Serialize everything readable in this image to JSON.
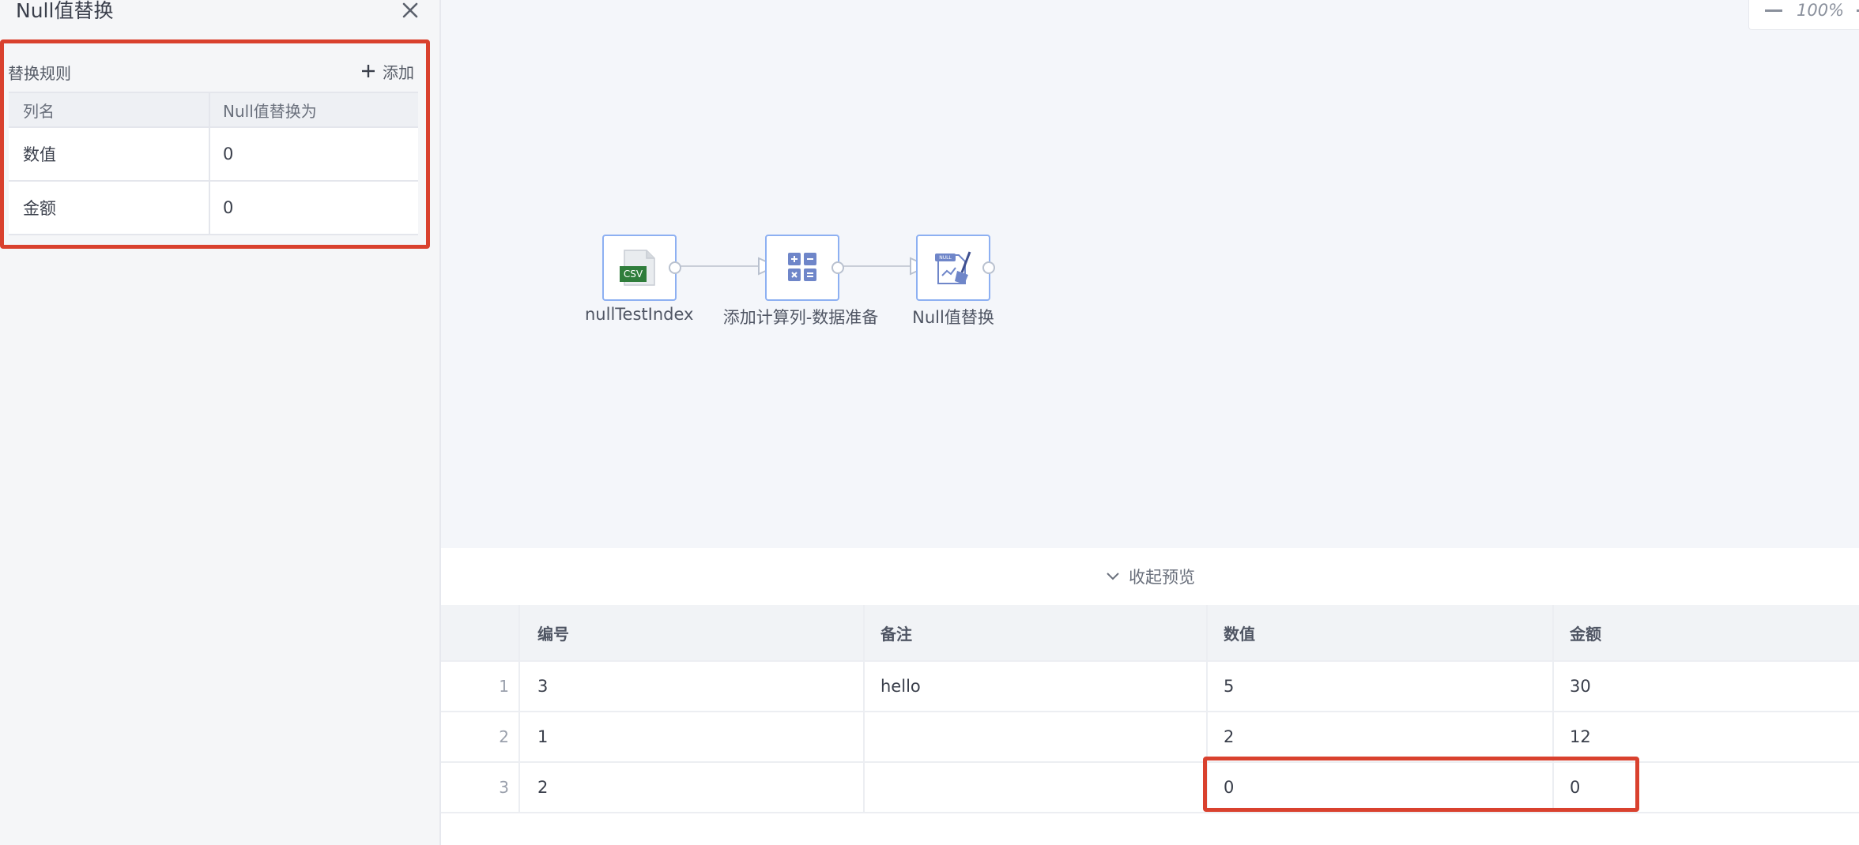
{
  "panel": {
    "title": "Null值替换",
    "rules_label": "替换规则",
    "add_label": "添加",
    "table_headers": [
      "列名",
      "Null值替换为"
    ],
    "rows": [
      {
        "column": "数值",
        "value": "0"
      },
      {
        "column": "金额",
        "value": "0"
      }
    ]
  },
  "zoom": {
    "value": "100%"
  },
  "flow": {
    "nodes": [
      {
        "label": "nullTestIndex",
        "icon": "csv-file-icon",
        "badge": "CSV"
      },
      {
        "label": "添加计算列-数据准备",
        "icon": "calculator-icon"
      },
      {
        "label": "Null值替换",
        "icon": "null-replace-broom-icon",
        "badge": "NULL"
      }
    ]
  },
  "preview": {
    "collapse_label": "收起预览",
    "headers": [
      "编号",
      "备注",
      "数值",
      "金额"
    ],
    "rows": [
      {
        "index": "1",
        "cells": [
          "3",
          "hello",
          "5",
          "30"
        ]
      },
      {
        "index": "2",
        "cells": [
          "1",
          "",
          "2",
          "12"
        ]
      },
      {
        "index": "3",
        "cells": [
          "2",
          "",
          "0",
          "0"
        ]
      }
    ]
  },
  "colors": {
    "highlight": "#d9412e",
    "node_border": "#8db0f2",
    "csv_green": "#2f7d3b",
    "calc_blue": "#6f86c9"
  }
}
